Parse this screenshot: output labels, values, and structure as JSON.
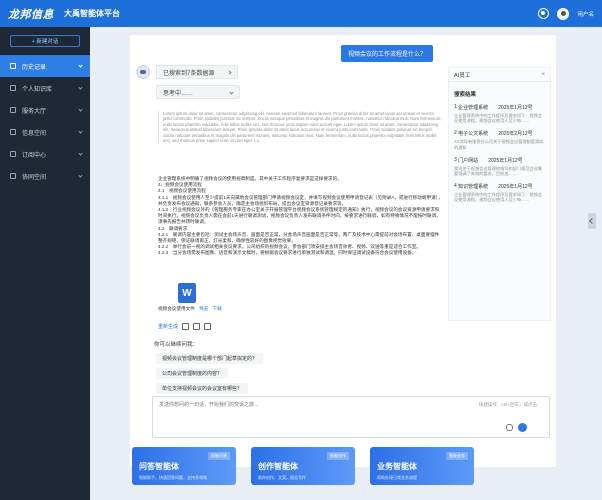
{
  "header": {
    "logo": "龙邦信息",
    "title": "大禹智能体平台",
    "username": "用户名"
  },
  "sidebar": {
    "new_chat": "+ 新建对话",
    "items": [
      {
        "label": "历史记录",
        "active": true
      },
      {
        "label": "个人知识库",
        "active": false
      },
      {
        "label": "服务大厅",
        "active": false
      },
      {
        "label": "信息空间",
        "active": false
      },
      {
        "label": "订阅中心",
        "active": false
      },
      {
        "label": "协同空间",
        "active": false
      }
    ]
  },
  "chat": {
    "user_message": "视频会议的工作流程是什么？",
    "search_pill": "已搜索到7条数据源",
    "thinking_pill": "思考中……",
    "lorem": "Lorem ipsum dolor sit amet, consectetur adipiscing elit. Aenean euismod bibendum laoreet. Proin gravida dolor sit amet lacus accumsan et viverra justo commodo. Proin sodales pulvinar sic tempor. Sociis natoque penatibus et magnis dis parturient montes, nascetur ridiculus mus. Nam fermentum, nulla luctus pharetra vulputate, felis tellus mollis orci, sed rhoncus proin sapien nunc accuet eget. Lorem ipsum dolor sit amet, consectetur adipiscing elit. Aenean euismod bibendum laoreet. Proin gravida dolor sit amet lacus accumsan et viverra justo commodo. Proin sodales pulvinar sic tempor. Sociis natoque penatibus et magnis dis parturient montes, nascetur ridiculus mus. Nam fermentum, nulla luctus pharetra vulputate, felis tellus mollis orci, sed rhoncus proin sapien nunc accuet eget. Lo",
    "answer_lines": [
      "企业管理系统中明确了视频会议的使用规章制度。其中关于工作程序复要求是这样要求的。",
      "4、视频会议使用流程",
      "4.1　视频会议使用流程",
      "4.1.1　视频会议使用人至少提前1天向属地会议管理部门申请视频会议室，并填写视频会议使用申请登记表（见附录A，或进行移动端申请），并负责发布会议通知，联系参会人员，确定主会场组织布局，提出会议室资源登记录要求等。",
      "4.1.2　行业视频会议外的《管理服务专家在办公室关于开展管理平台视频会议系统管理规定的通知》执行，视频会议的会议资源申请要求和时间执行。视频会议负责人需在会前1天进行联调测试，视频会议负责人发布联调条件时间，按要求进行联调，如有特殊情况不能按时联调，须事先报告并转时联调。",
      "4.2　联调要求",
      "4.2.1　联调内容主要包括：测试主会场声音、画面是否正常，分会场声音画面是否正常等。两广及技术中心需提前对会场布置、桌面要摆件整齐规矩，保证联调再正，灯光柔和，确保性较好的图像视觉效果。",
      "4.2.2　举行会前一视的调试相关会议要求，公司组织的视频会议，参会部门须安排主会场音效者、视频、双送等重是适合工作室。",
      "4.2.3　当分会场需发布图像、语音和演示文稿时，要根据会议要求进行单独测试和调温，同时保证调试设备符合会议使用设备。"
    ],
    "file": {
      "icon_letter": "W",
      "name": "视频会议使用文件",
      "preview": "预览",
      "download": "下载"
    },
    "regenerate": "重新生成",
    "followups_title": "你可以继续问我：",
    "followups": [
      "视频会议管理制度是哪个部门起草拟定的？",
      "公司会议管理制度的内容？",
      "单位支持视频会议的会议室有哪些？"
    ],
    "input_placeholder": "发送你想问的一句话，开始我们的交谈之旅...",
    "input_hint": "快捷操作：ctrl+回车，或点击"
  },
  "search_panel": {
    "header": "AI员工",
    "close": "×",
    "title": "搜索结果",
    "results": [
      {
        "index": "1",
        "name": "企业管理系统",
        "date": "2025年1月12号",
        "desc": "企业管理系统中的工作程序及要求如下：视频会议使用流程。视频会议使用人至少每……"
      },
      {
        "index": "2",
        "name": "电子公文系统",
        "date": "2025年2月12号",
        "desc": "XX领导有限责任公司关于视频会议管理制度落实的通知"
      },
      {
        "index": "3",
        "name": "门户网站",
        "date": "2025年1月12号",
        "desc": "我司关于视频会议管理的指导和部门规范会议需要强调了有效的要求，目前加……"
      },
      {
        "index": "4",
        "name": "知识管理系统",
        "date": "2025年1月12号",
        "desc": "企业管理系统中的工作程序及要求如下：视频会议使用流程。视频会议使用人至少每……"
      }
    ]
  },
  "agents": [
    {
      "title": "问答智能体",
      "desc": "智能助手，快速回答问题，支持多领域",
      "tag": "智能问答"
    },
    {
      "title": "创作智能体",
      "desc": "助你创作，文案，报告写作",
      "tag": "智能创作"
    },
    {
      "title": "业务智能体",
      "desc": "帮助处理日常业务流程",
      "tag": "智能业务"
    }
  ]
}
